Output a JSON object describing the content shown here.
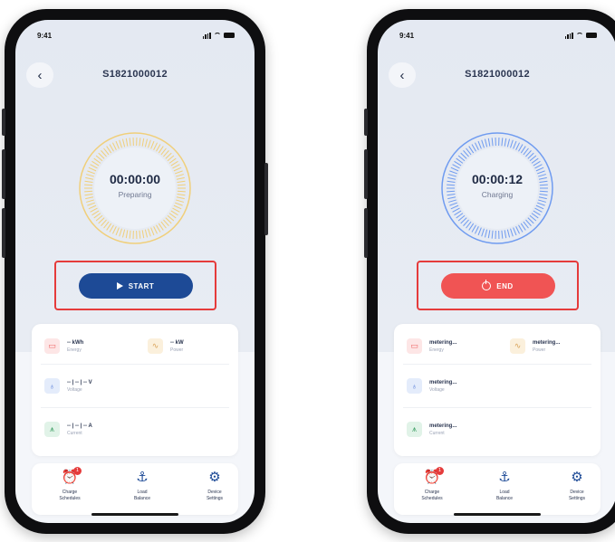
{
  "phones": [
    {
      "status_time": "9:41",
      "device_id": "S1821000012",
      "back_label": "‹",
      "timer": {
        "value": "00:00:00",
        "status": "Preparing",
        "ring_color": "#f0cf7a"
      },
      "action": {
        "label": "START",
        "color": "#1d4a96",
        "icon": "play-icon"
      },
      "metrics": {
        "energy": {
          "value": "-- kWh",
          "label": "Energy"
        },
        "power": {
          "value": "-- kW",
          "label": "Power"
        },
        "voltage": {
          "value": "-- | -- | -- V",
          "label": "Voltage"
        },
        "current": {
          "value": "-- | -- | -- A",
          "label": "Current"
        }
      },
      "nav": [
        {
          "label": "Charge\nSchedules",
          "icon": "alarm-clock-icon",
          "badge": "1"
        },
        {
          "label": "Load\nBalance",
          "icon": "anchor-icon"
        },
        {
          "label": "Device\nSettings",
          "icon": "gear-icon"
        }
      ]
    },
    {
      "status_time": "9:41",
      "device_id": "S1821000012",
      "back_label": "‹",
      "timer": {
        "value": "00:00:12",
        "status": "Charging",
        "ring_color": "#6f9bf0"
      },
      "action": {
        "label": "END",
        "color": "#f05454",
        "icon": "power-icon"
      },
      "metrics": {
        "energy": {
          "value": "metering...",
          "label": "Energy"
        },
        "power": {
          "value": "metering...",
          "label": "Power"
        },
        "voltage": {
          "value": "metering...",
          "label": "Voltage"
        },
        "current": {
          "value": "metering...",
          "label": "Current"
        }
      },
      "nav": [
        {
          "label": "Charge\nSchedules",
          "icon": "alarm-clock-icon",
          "badge": "1"
        },
        {
          "label": "Load\nBalance",
          "icon": "anchor-icon"
        },
        {
          "label": "Device\nSettings",
          "icon": "gear-icon"
        }
      ]
    }
  ],
  "colors": {
    "highlight": "#e53b3b",
    "primary": "#1d4a96"
  }
}
